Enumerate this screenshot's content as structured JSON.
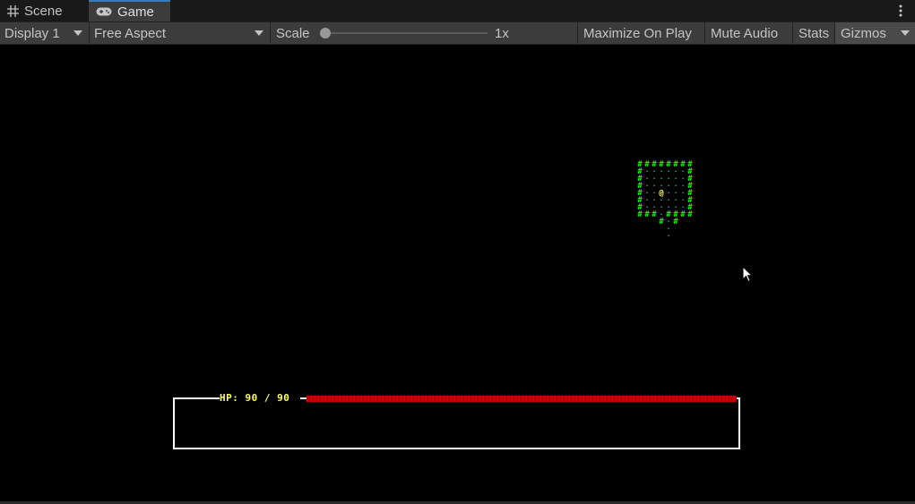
{
  "tabs": [
    {
      "label": "Scene",
      "icon": "grid-icon"
    },
    {
      "label": "Game",
      "icon": "gamepad-icon",
      "active": true
    }
  ],
  "toolbar": {
    "display": "Display 1",
    "aspect": "Free Aspect",
    "scale_label": "Scale",
    "scale_value": "1x",
    "maximize": "Maximize On Play",
    "mute": "Mute Audio",
    "stats": "Stats",
    "gizmos": "Gizmos"
  },
  "game": {
    "hp_text": "HP: 90 / 90",
    "hp_current": 90,
    "hp_max": 90,
    "player_glyph": "@",
    "wall_glyph": "#",
    "floor_glyph": "·",
    "colors": {
      "wall": "#00ff00",
      "floor": "#2aa8a8",
      "player": "#ffff55",
      "hp_bar": "#cc0000",
      "hp_text": "#ffff55",
      "frame": "#ffffff"
    }
  }
}
